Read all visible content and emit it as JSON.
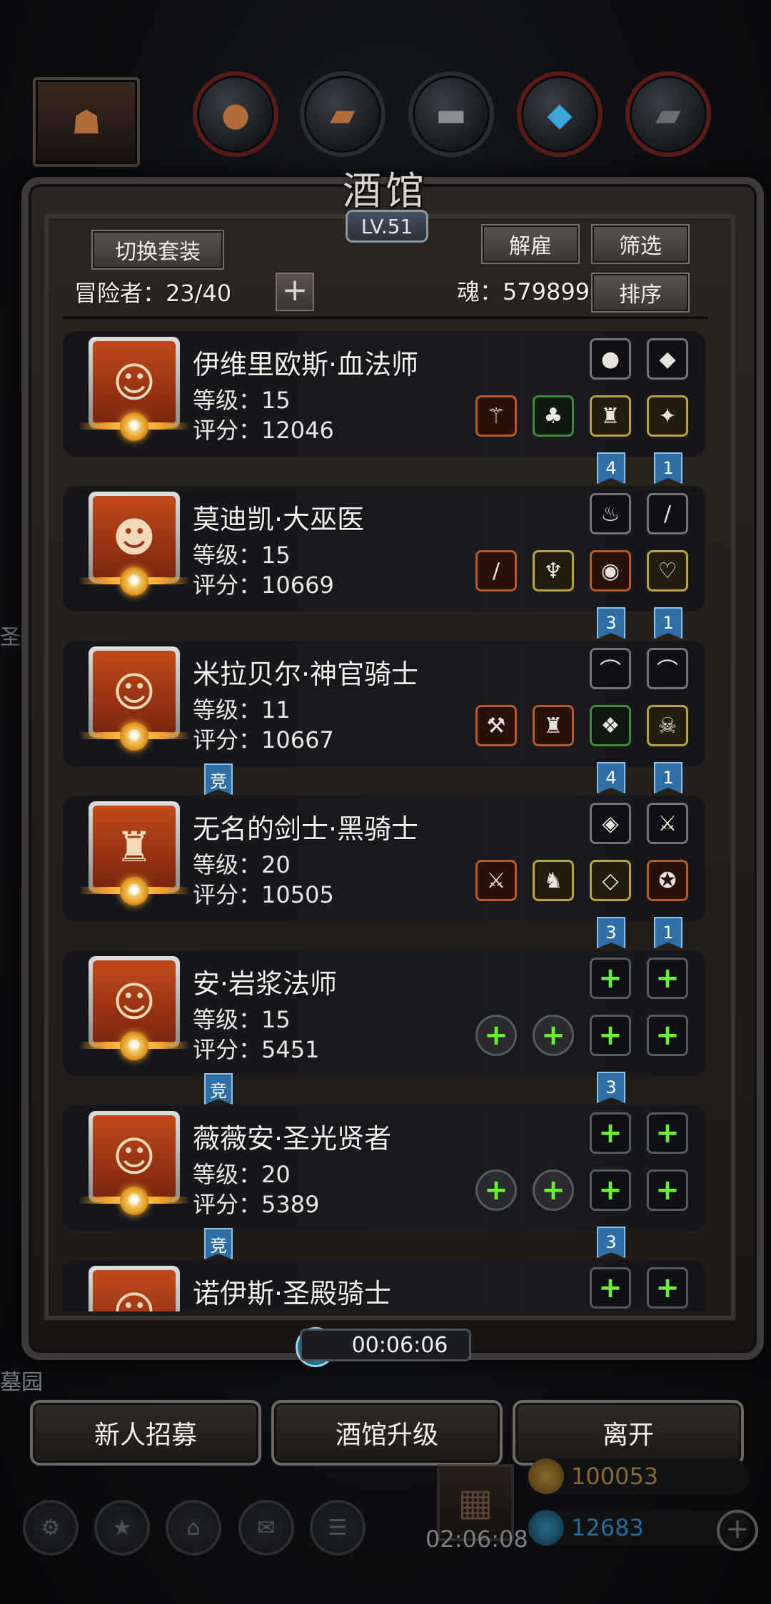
{
  "top_tabs": [
    "hood-icon",
    "basketball-icon",
    "wood-icon",
    "anvil-icon",
    "crystal-icon",
    "ingot-icon"
  ],
  "header": {
    "title": "酒馆",
    "level": "LV.51",
    "switch_suit": "切换套装",
    "dismiss": "解雇",
    "filter": "筛选",
    "sort": "排序",
    "adventurers": "冒险者：23/40",
    "soul": "魂：579899",
    "add": "+"
  },
  "heroes": [
    {
      "name": "伊维里欧斯·血法师",
      "level": "等级：15",
      "score": "评分：12046",
      "top_slots": [
        {
          "c": "grey",
          "g": "●"
        },
        {
          "c": "grey",
          "g": "◆"
        }
      ],
      "bottom_slots": [
        {
          "c": "orange",
          "g": "⚚"
        },
        {
          "c": "green",
          "g": "♣"
        },
        {
          "c": "gold",
          "g": "♜"
        },
        {
          "c": "gold",
          "g": "✦"
        }
      ],
      "tags": [
        {
          "t": "4",
          "p": 2
        },
        {
          "t": "1",
          "p": 3
        }
      ]
    },
    {
      "name": "莫迪凯·大巫医",
      "level": "等级：15",
      "score": "评分：10669",
      "top_slots": [
        {
          "c": "grey",
          "g": "♨"
        },
        {
          "c": "grey",
          "g": "∕"
        }
      ],
      "bottom_slots": [
        {
          "c": "orange",
          "g": "∕"
        },
        {
          "c": "gold",
          "g": "♆"
        },
        {
          "c": "orange",
          "g": "◉"
        },
        {
          "c": "gold",
          "g": "♡"
        }
      ],
      "tags": [
        {
          "t": "3",
          "p": 2
        },
        {
          "t": "1",
          "p": 3
        }
      ]
    },
    {
      "name": "米拉贝尔·神官骑士",
      "level": "等级：11",
      "score": "评分：10667",
      "top_slots": [
        {
          "c": "grey",
          "g": "⌒"
        },
        {
          "c": "grey",
          "g": "⌒"
        }
      ],
      "bottom_slots": [
        {
          "c": "orange",
          "g": "⚒"
        },
        {
          "c": "orange",
          "g": "♜"
        },
        {
          "c": "green",
          "g": "❖"
        },
        {
          "c": "gold",
          "g": "☠"
        }
      ],
      "tags": [
        {
          "t": "竞",
          "p": -1
        },
        {
          "t": "4",
          "p": 2
        },
        {
          "t": "1",
          "p": 3
        }
      ]
    },
    {
      "name": "无名的剑士·黑骑士",
      "level": "等级：20",
      "score": "评分：10505",
      "top_slots": [
        {
          "c": "grey",
          "g": "◈"
        },
        {
          "c": "grey",
          "g": "⚔"
        }
      ],
      "bottom_slots": [
        {
          "c": "orange",
          "g": "⚔"
        },
        {
          "c": "gold",
          "g": "♞"
        },
        {
          "c": "gold",
          "g": "◇"
        },
        {
          "c": "orange",
          "g": "✪"
        }
      ],
      "tags": [
        {
          "t": "3",
          "p": 2
        },
        {
          "t": "1",
          "p": 3
        }
      ]
    },
    {
      "name": "安·岩浆法师",
      "level": "等级：15",
      "score": "评分：5451",
      "top_slots": [
        {
          "c": "empty",
          "g": "+"
        },
        {
          "c": "empty",
          "g": "+"
        }
      ],
      "bottom_slots": [
        {
          "c": "empty-round",
          "g": "+"
        },
        {
          "c": "empty-round",
          "g": "+"
        },
        {
          "c": "empty",
          "g": "+"
        },
        {
          "c": "empty",
          "g": "+"
        }
      ],
      "tags": [
        {
          "t": "竞",
          "p": -1
        },
        {
          "t": "3",
          "p": 2
        }
      ]
    },
    {
      "name": "薇薇安·圣光贤者",
      "level": "等级：20",
      "score": "评分：5389",
      "top_slots": [
        {
          "c": "empty",
          "g": "+"
        },
        {
          "c": "empty",
          "g": "+"
        }
      ],
      "bottom_slots": [
        {
          "c": "empty-round",
          "g": "+"
        },
        {
          "c": "empty-round",
          "g": "+"
        },
        {
          "c": "empty",
          "g": "+"
        },
        {
          "c": "empty",
          "g": "+"
        }
      ],
      "tags": [
        {
          "t": "竞",
          "p": -1
        },
        {
          "t": "3",
          "p": 2
        }
      ]
    },
    {
      "name": "诺伊斯·圣殿骑士",
      "level": "",
      "score": "",
      "top_slots": [
        {
          "c": "empty",
          "g": "+"
        },
        {
          "c": "empty",
          "g": "+"
        }
      ],
      "bottom_slots": [],
      "tags": []
    }
  ],
  "timer": "00:06:06",
  "buttons": {
    "recruit": "新人招募",
    "upgrade": "酒馆升级",
    "leave": "离开"
  },
  "dock": {
    "gift_timer": "02:06:08",
    "gold": "100053",
    "gems": "12683"
  },
  "side": {
    "left_a": "圣迹",
    "left_b": "墓园"
  }
}
